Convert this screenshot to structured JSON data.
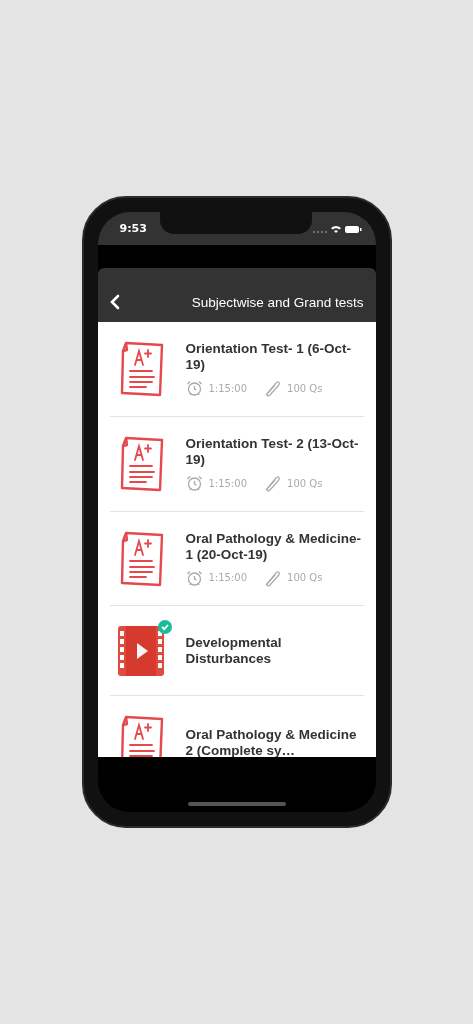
{
  "status_bar": {
    "time": "9:53"
  },
  "header": {
    "title": "Subjectwise and Grand tests"
  },
  "items": [
    {
      "kind": "test",
      "title": "Orientation Test- 1 (6-Oct-19)",
      "duration": "1:15:00",
      "questions": "100 Qs"
    },
    {
      "kind": "test",
      "title": "Orientation Test- 2 (13-Oct-19)",
      "duration": "1:15:00",
      "questions": "100 Qs"
    },
    {
      "kind": "test",
      "title": "Oral Pathology & Medicine-1 (20-Oct-19)",
      "duration": "1:15:00",
      "questions": "100 Qs"
    },
    {
      "kind": "video",
      "title": "Developmental Disturbances",
      "completed": true
    },
    {
      "kind": "test",
      "title": "Oral Pathology & Medicine 2 (Complete sy…"
    }
  ]
}
